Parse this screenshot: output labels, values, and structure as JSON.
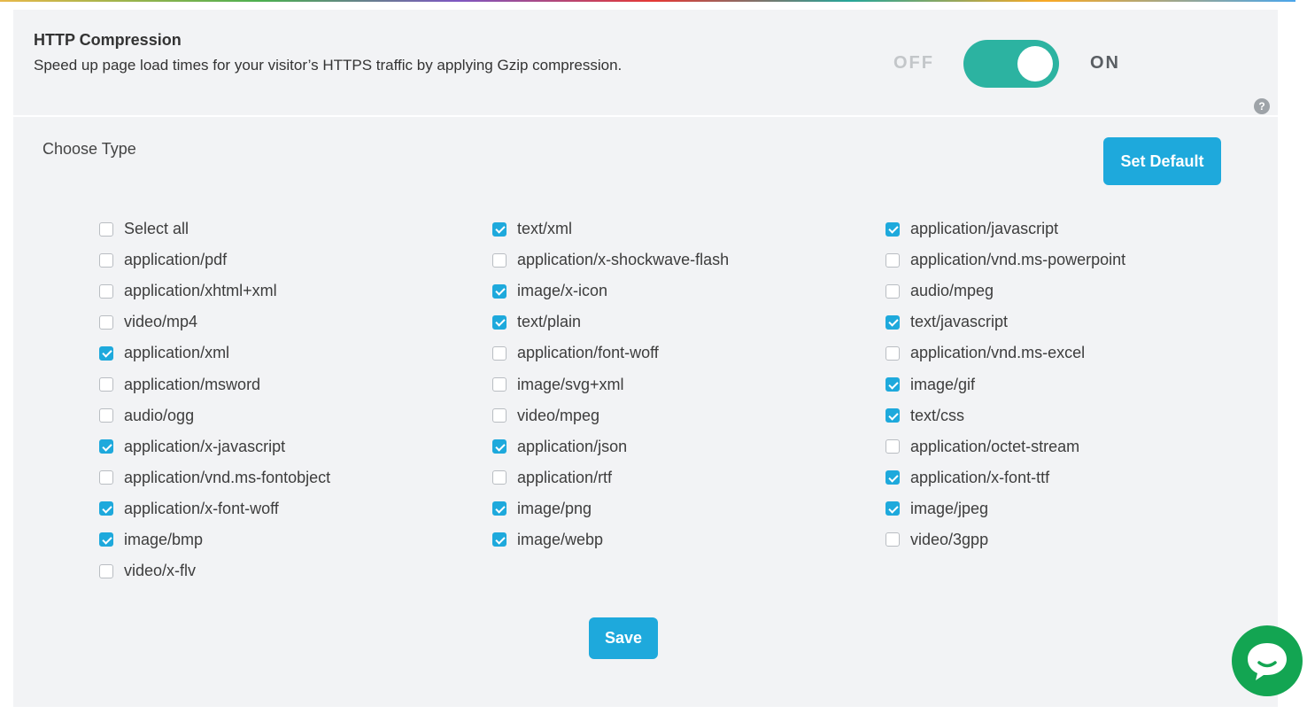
{
  "section": {
    "title": "HTTP Compression",
    "description": "Speed up page load times for your visitor’s HTTPS traffic by applying Gzip compression."
  },
  "toggle": {
    "off_label": "OFF",
    "on_label": "ON",
    "state": "on",
    "accent": "#2cb3a1"
  },
  "help": {
    "icon_text": "?"
  },
  "types": {
    "heading": "Choose Type",
    "set_default_label": "Set Default",
    "columns": [
      [
        {
          "label": "Select all",
          "checked": false
        },
        {
          "label": "application/pdf",
          "checked": false
        },
        {
          "label": "application/xhtml+xml",
          "checked": false
        },
        {
          "label": "video/mp4",
          "checked": false
        },
        {
          "label": "application/xml",
          "checked": true
        },
        {
          "label": "application/msword",
          "checked": false
        },
        {
          "label": "audio/ogg",
          "checked": false
        },
        {
          "label": "application/x-javascript",
          "checked": true
        },
        {
          "label": "application/vnd.ms-fontobject",
          "checked": false
        },
        {
          "label": "application/x-font-woff",
          "checked": true
        },
        {
          "label": "image/bmp",
          "checked": true
        },
        {
          "label": "video/x-flv",
          "checked": false
        }
      ],
      [
        {
          "label": "text/xml",
          "checked": true
        },
        {
          "label": "application/x-shockwave-flash",
          "checked": false
        },
        {
          "label": "image/x-icon",
          "checked": true
        },
        {
          "label": "text/plain",
          "checked": true
        },
        {
          "label": "application/font-woff",
          "checked": false
        },
        {
          "label": "image/svg+xml",
          "checked": false
        },
        {
          "label": "video/mpeg",
          "checked": false
        },
        {
          "label": "application/json",
          "checked": true
        },
        {
          "label": "application/rtf",
          "checked": false
        },
        {
          "label": "image/png",
          "checked": true
        },
        {
          "label": "image/webp",
          "checked": true
        }
      ],
      [
        {
          "label": "application/javascript",
          "checked": true
        },
        {
          "label": "application/vnd.ms-powerpoint",
          "checked": false
        },
        {
          "label": "audio/mpeg",
          "checked": false
        },
        {
          "label": "text/javascript",
          "checked": true
        },
        {
          "label": "application/vnd.ms-excel",
          "checked": false
        },
        {
          "label": "image/gif",
          "checked": true
        },
        {
          "label": "text/css",
          "checked": true
        },
        {
          "label": "application/octet-stream",
          "checked": false
        },
        {
          "label": "application/x-font-ttf",
          "checked": true
        },
        {
          "label": "image/jpeg",
          "checked": true
        },
        {
          "label": "video/3gpp",
          "checked": false
        }
      ]
    ]
  },
  "save_label": "Save",
  "chat": {
    "icon": "chat-bubble-icon",
    "color": "#13a552"
  },
  "colors": {
    "primary": "#1ea9dc",
    "panel_bg": "#f2f3f5"
  }
}
